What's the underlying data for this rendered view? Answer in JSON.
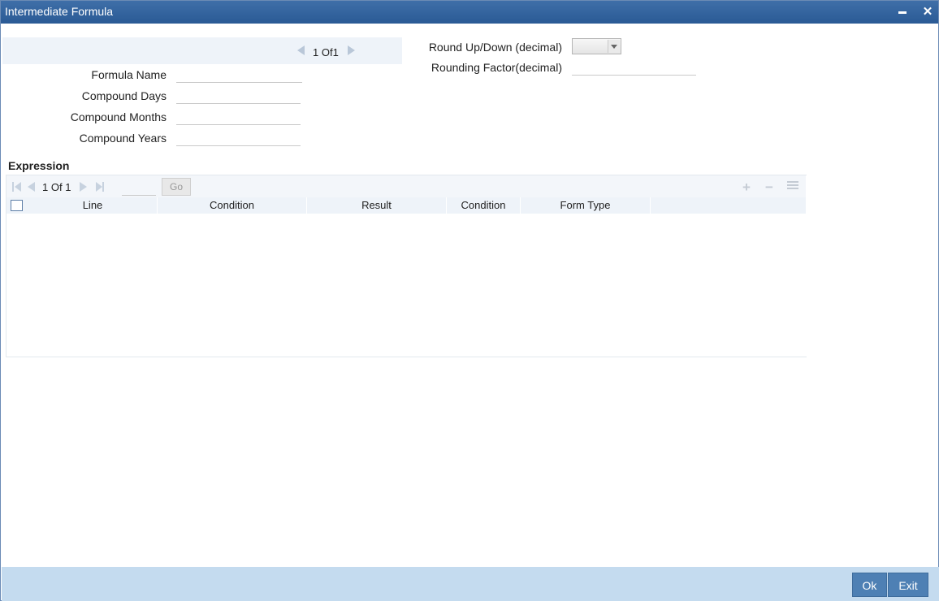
{
  "window": {
    "title": "Intermediate Formula"
  },
  "record_pager": {
    "current": "1",
    "of_label": "Of",
    "total": "1"
  },
  "form": {
    "formula_name_label": "Formula Name",
    "compound_days_label": "Compound Days",
    "compound_months_label": "Compound Months",
    "compound_years_label": "Compound Years",
    "round_label": "Round Up/Down (decimal)",
    "rounding_factor_label": "Rounding Factor(decimal)",
    "formula_name_value": "",
    "compound_days_value": "",
    "compound_months_value": "",
    "compound_years_value": "",
    "round_value": "",
    "rounding_factor_value": ""
  },
  "expression": {
    "title": "Expression",
    "pager": {
      "current": "1",
      "of_label": "Of",
      "total": "1"
    },
    "go_label": "Go",
    "columns": [
      "Line",
      "Condition",
      "Result",
      "Condition",
      "Form Type"
    ],
    "rows": []
  },
  "footer": {
    "ok_label": "Ok",
    "exit_label": "Exit"
  }
}
